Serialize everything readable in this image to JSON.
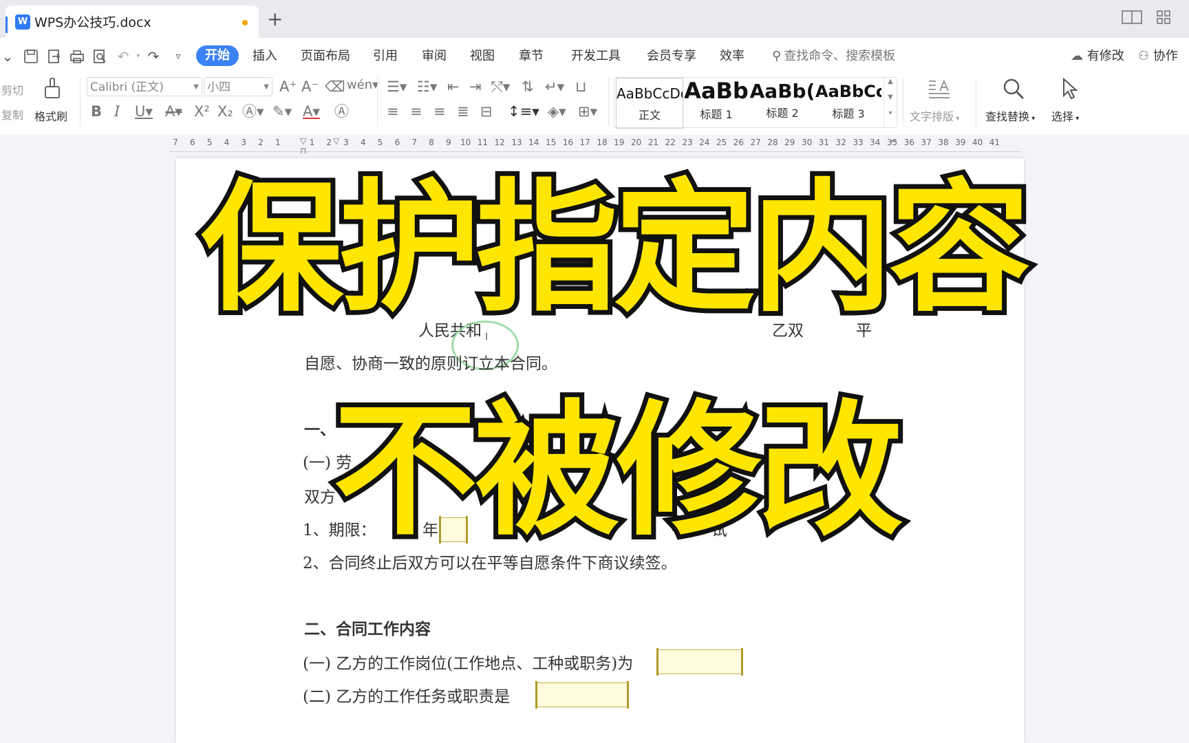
{
  "tabbar": {
    "doc_icon": "W",
    "active_tab_title": "WPS办公技巧.docx",
    "new_tab": "+",
    "window_icons": [
      "layout-icon",
      "grid-icon"
    ]
  },
  "menu": {
    "tabs": [
      "开始",
      "插入",
      "页面布局",
      "引用",
      "审阅",
      "视图",
      "章节",
      "开发工具",
      "会员专享",
      "效率"
    ],
    "search_placeholder": "查找命令、搜索模板",
    "right_actions": [
      "有修改",
      "协作"
    ]
  },
  "ribbon": {
    "cut": "剪切",
    "copy": "复制",
    "format_painter": "格式刷",
    "font_name": "Calibri (正文)",
    "font_size": "小四",
    "styles": [
      {
        "preview": "AaBbCcDd",
        "name": "正文"
      },
      {
        "preview": "AaBb",
        "name": "标题 1"
      },
      {
        "preview": "AaBb(",
        "name": "标题 2"
      },
      {
        "preview": "AaBbCc",
        "name": "标题 3"
      }
    ],
    "text_layout": "文字排版",
    "find_replace": "查找替换",
    "select": "选择"
  },
  "ruler": {
    "numbers": [
      "7",
      "6",
      "5",
      "4",
      "3",
      "2",
      "1",
      "",
      "1",
      "2",
      "3",
      "4",
      "5",
      "6",
      "7",
      "8",
      "9",
      "10",
      "11",
      "12",
      "13",
      "14",
      "15",
      "16",
      "17",
      "18",
      "19",
      "20",
      "21",
      "22",
      "23",
      "24",
      "25",
      "26",
      "27",
      "28",
      "29",
      "30",
      "31",
      "32",
      "33",
      "34",
      "35",
      "36",
      "37",
      "38",
      "39",
      "40",
      "41"
    ]
  },
  "document": {
    "frag_1": "人民共和",
    "frag_2": "乙双",
    "frag_3": "平",
    "line_2": "自愿、协商一致的原则订立本合同。",
    "frag_4": "一、",
    "frag_5": "(一)  劳",
    "frag_6": "双方",
    "line_7a": "1、期限：",
    "line_7b": "年",
    "line_7c": "试",
    "line_8": "2、合同终止后双方可以在平等自愿条件下商议续签。",
    "heading_2": "二、合同工作内容",
    "line_10": "(一)  乙方的工作岗位(工作地点、工种或职务)为",
    "line_11": "(二)  乙方的工作任务或职责是"
  },
  "overlay": {
    "line_1": "保护指定内容",
    "line_2": "不被修改"
  },
  "colors": {
    "accent_blue": "#3b82f6",
    "overlay_yellow": "#ffe600",
    "overlay_stroke": "#111111",
    "field_fill": "#fffbdc",
    "field_border": "#c8b24a"
  }
}
